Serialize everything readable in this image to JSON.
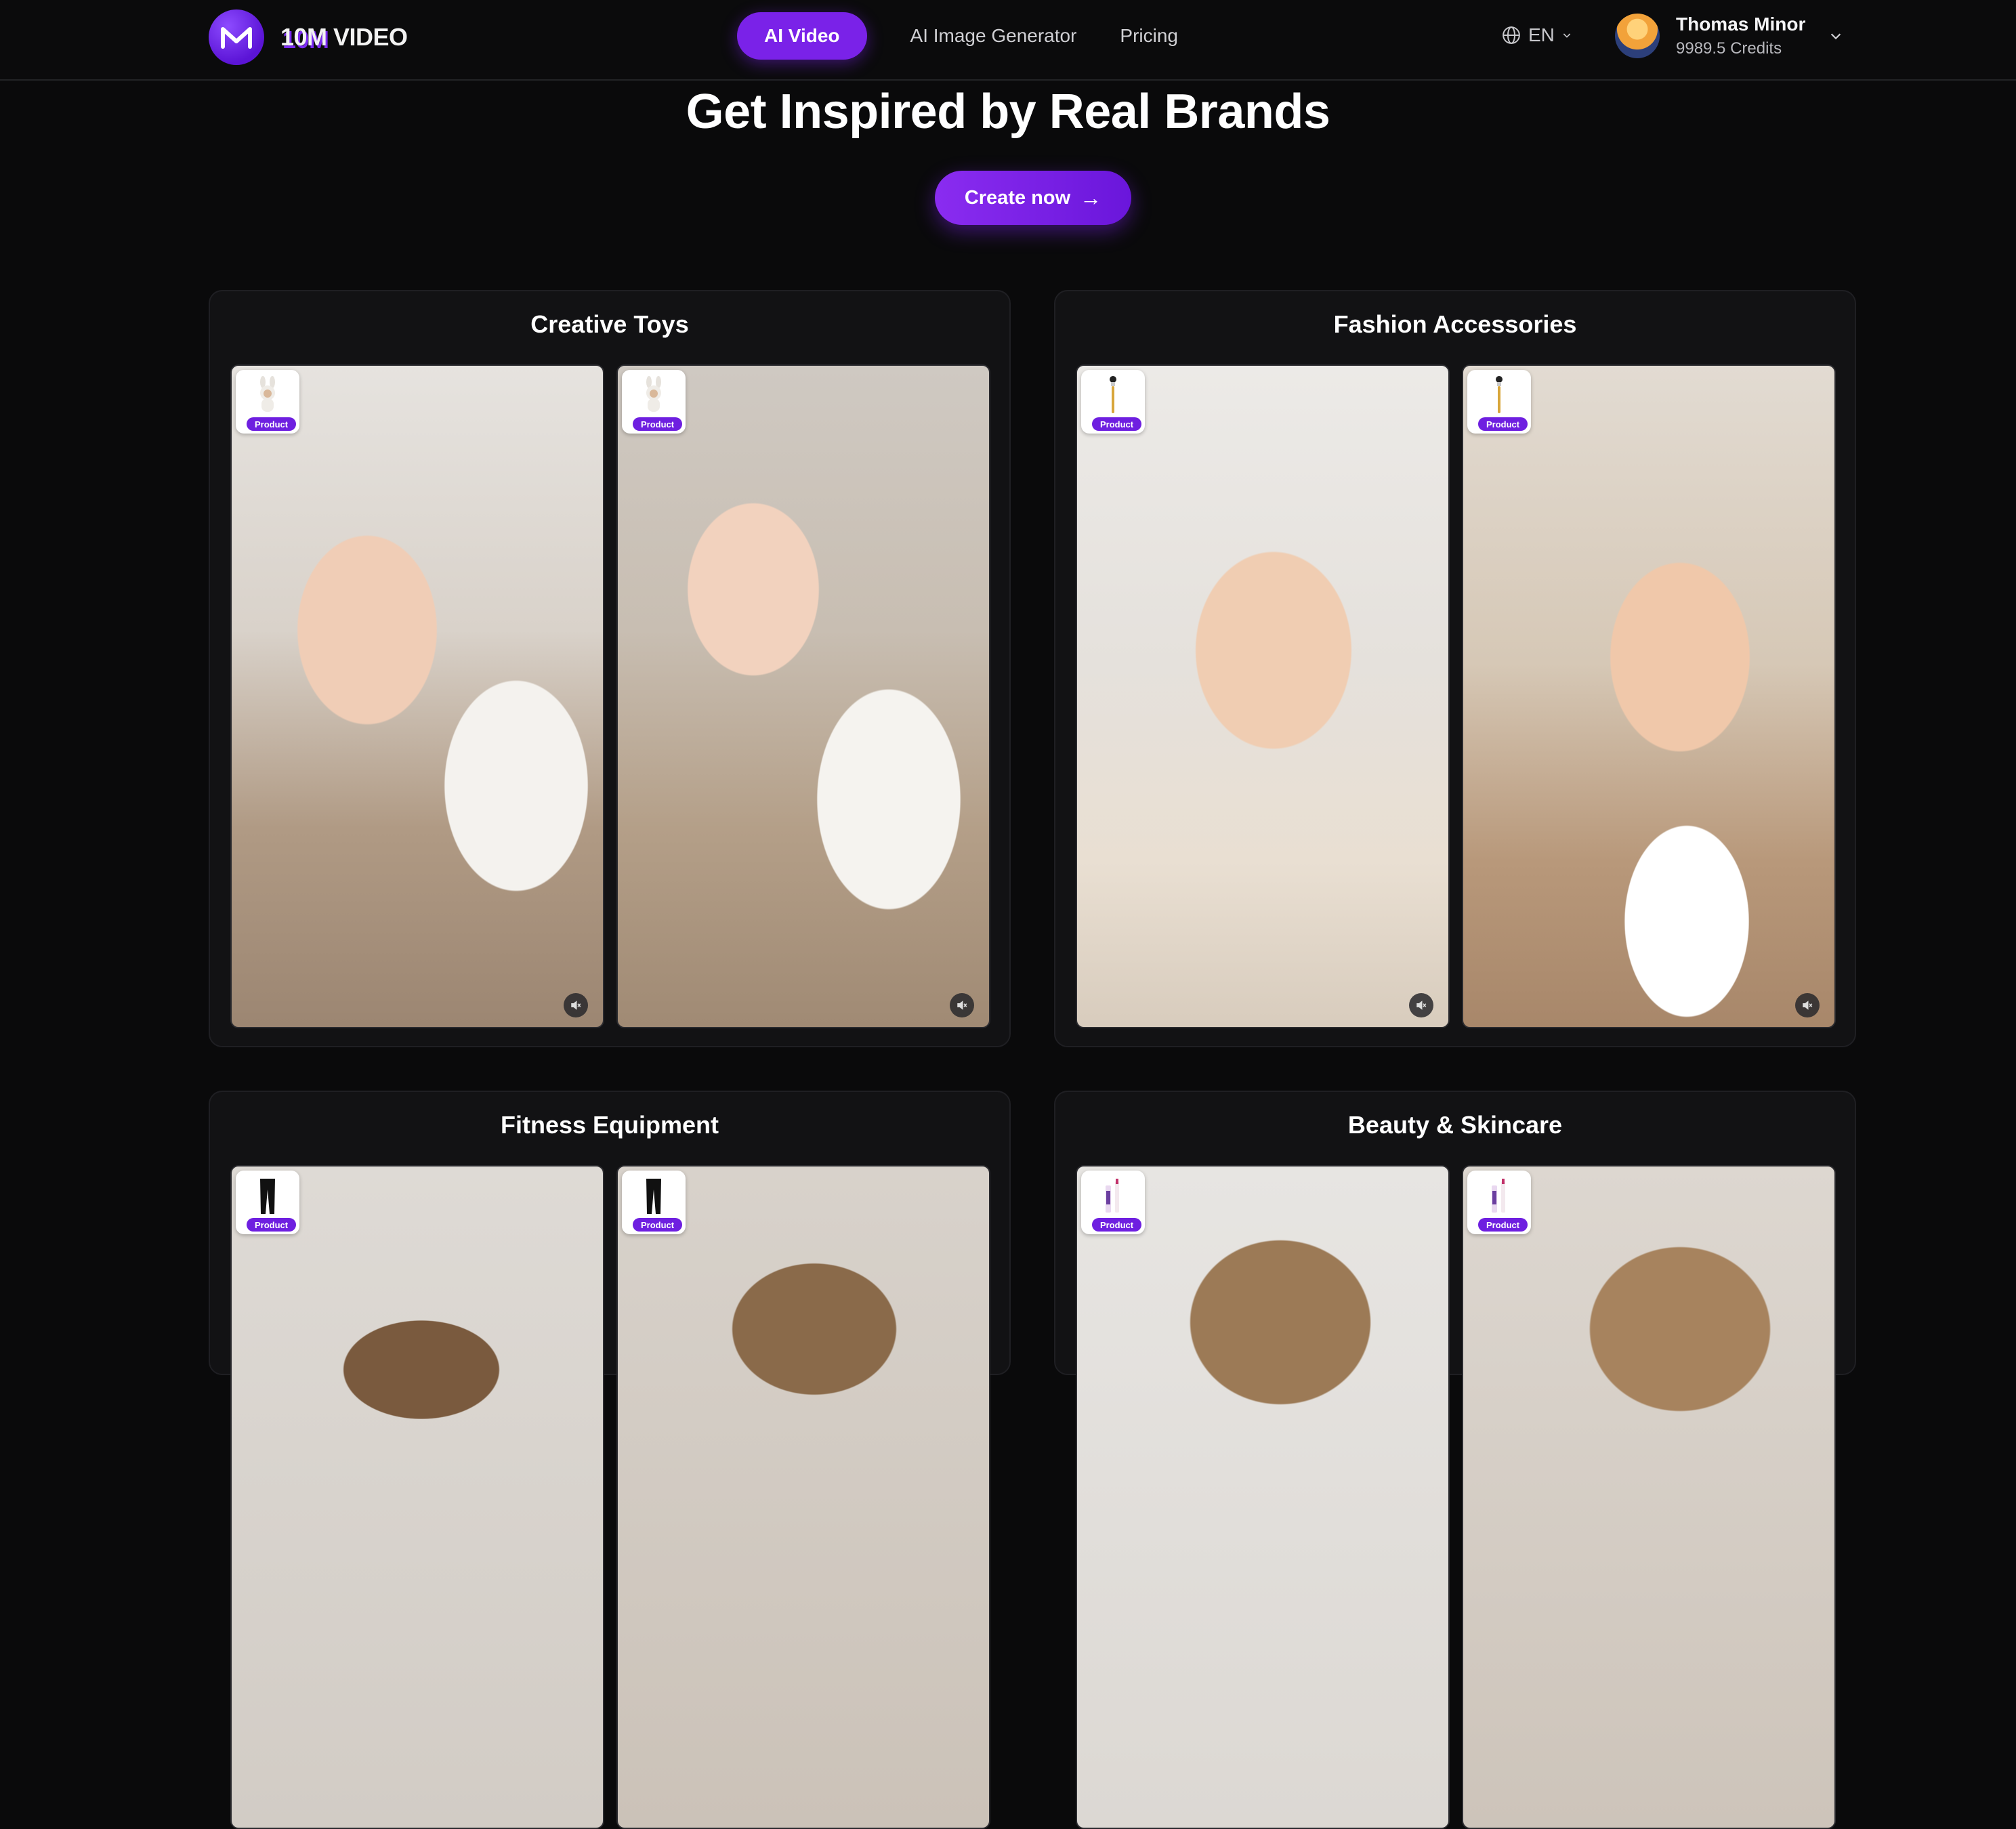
{
  "brand": {
    "name_accent": "10M",
    "name_rest": " VIDEO",
    "logo_letter": "M"
  },
  "nav": {
    "items": [
      {
        "label": "AI Video",
        "active": true
      },
      {
        "label": "AI Image Generator",
        "active": false
      },
      {
        "label": "Pricing",
        "active": false
      }
    ]
  },
  "language": {
    "label": "EN"
  },
  "user": {
    "name": "Thomas Minor",
    "credits": "9989.5 Credits"
  },
  "hero": {
    "title": "Get Inspired by Real Brands",
    "cta_label": "Create now",
    "cta_arrow": "→"
  },
  "badge_label": "Product",
  "categories": [
    {
      "title": "Creative Toys",
      "videos": [
        "toy-video-1",
        "toy-video-2"
      ]
    },
    {
      "title": "Fashion Accessories",
      "videos": [
        "fashion-video-1",
        "fashion-video-2"
      ]
    },
    {
      "title": "Fitness Equipment",
      "videos": [
        "fitness-video-1",
        "fitness-video-2"
      ]
    },
    {
      "title": "Beauty & Skincare",
      "videos": [
        "beauty-video-1",
        "beauty-video-2"
      ]
    }
  ],
  "colors": {
    "accent": "#7a22e8",
    "background": "#0a0a0b",
    "card": "#121214"
  }
}
